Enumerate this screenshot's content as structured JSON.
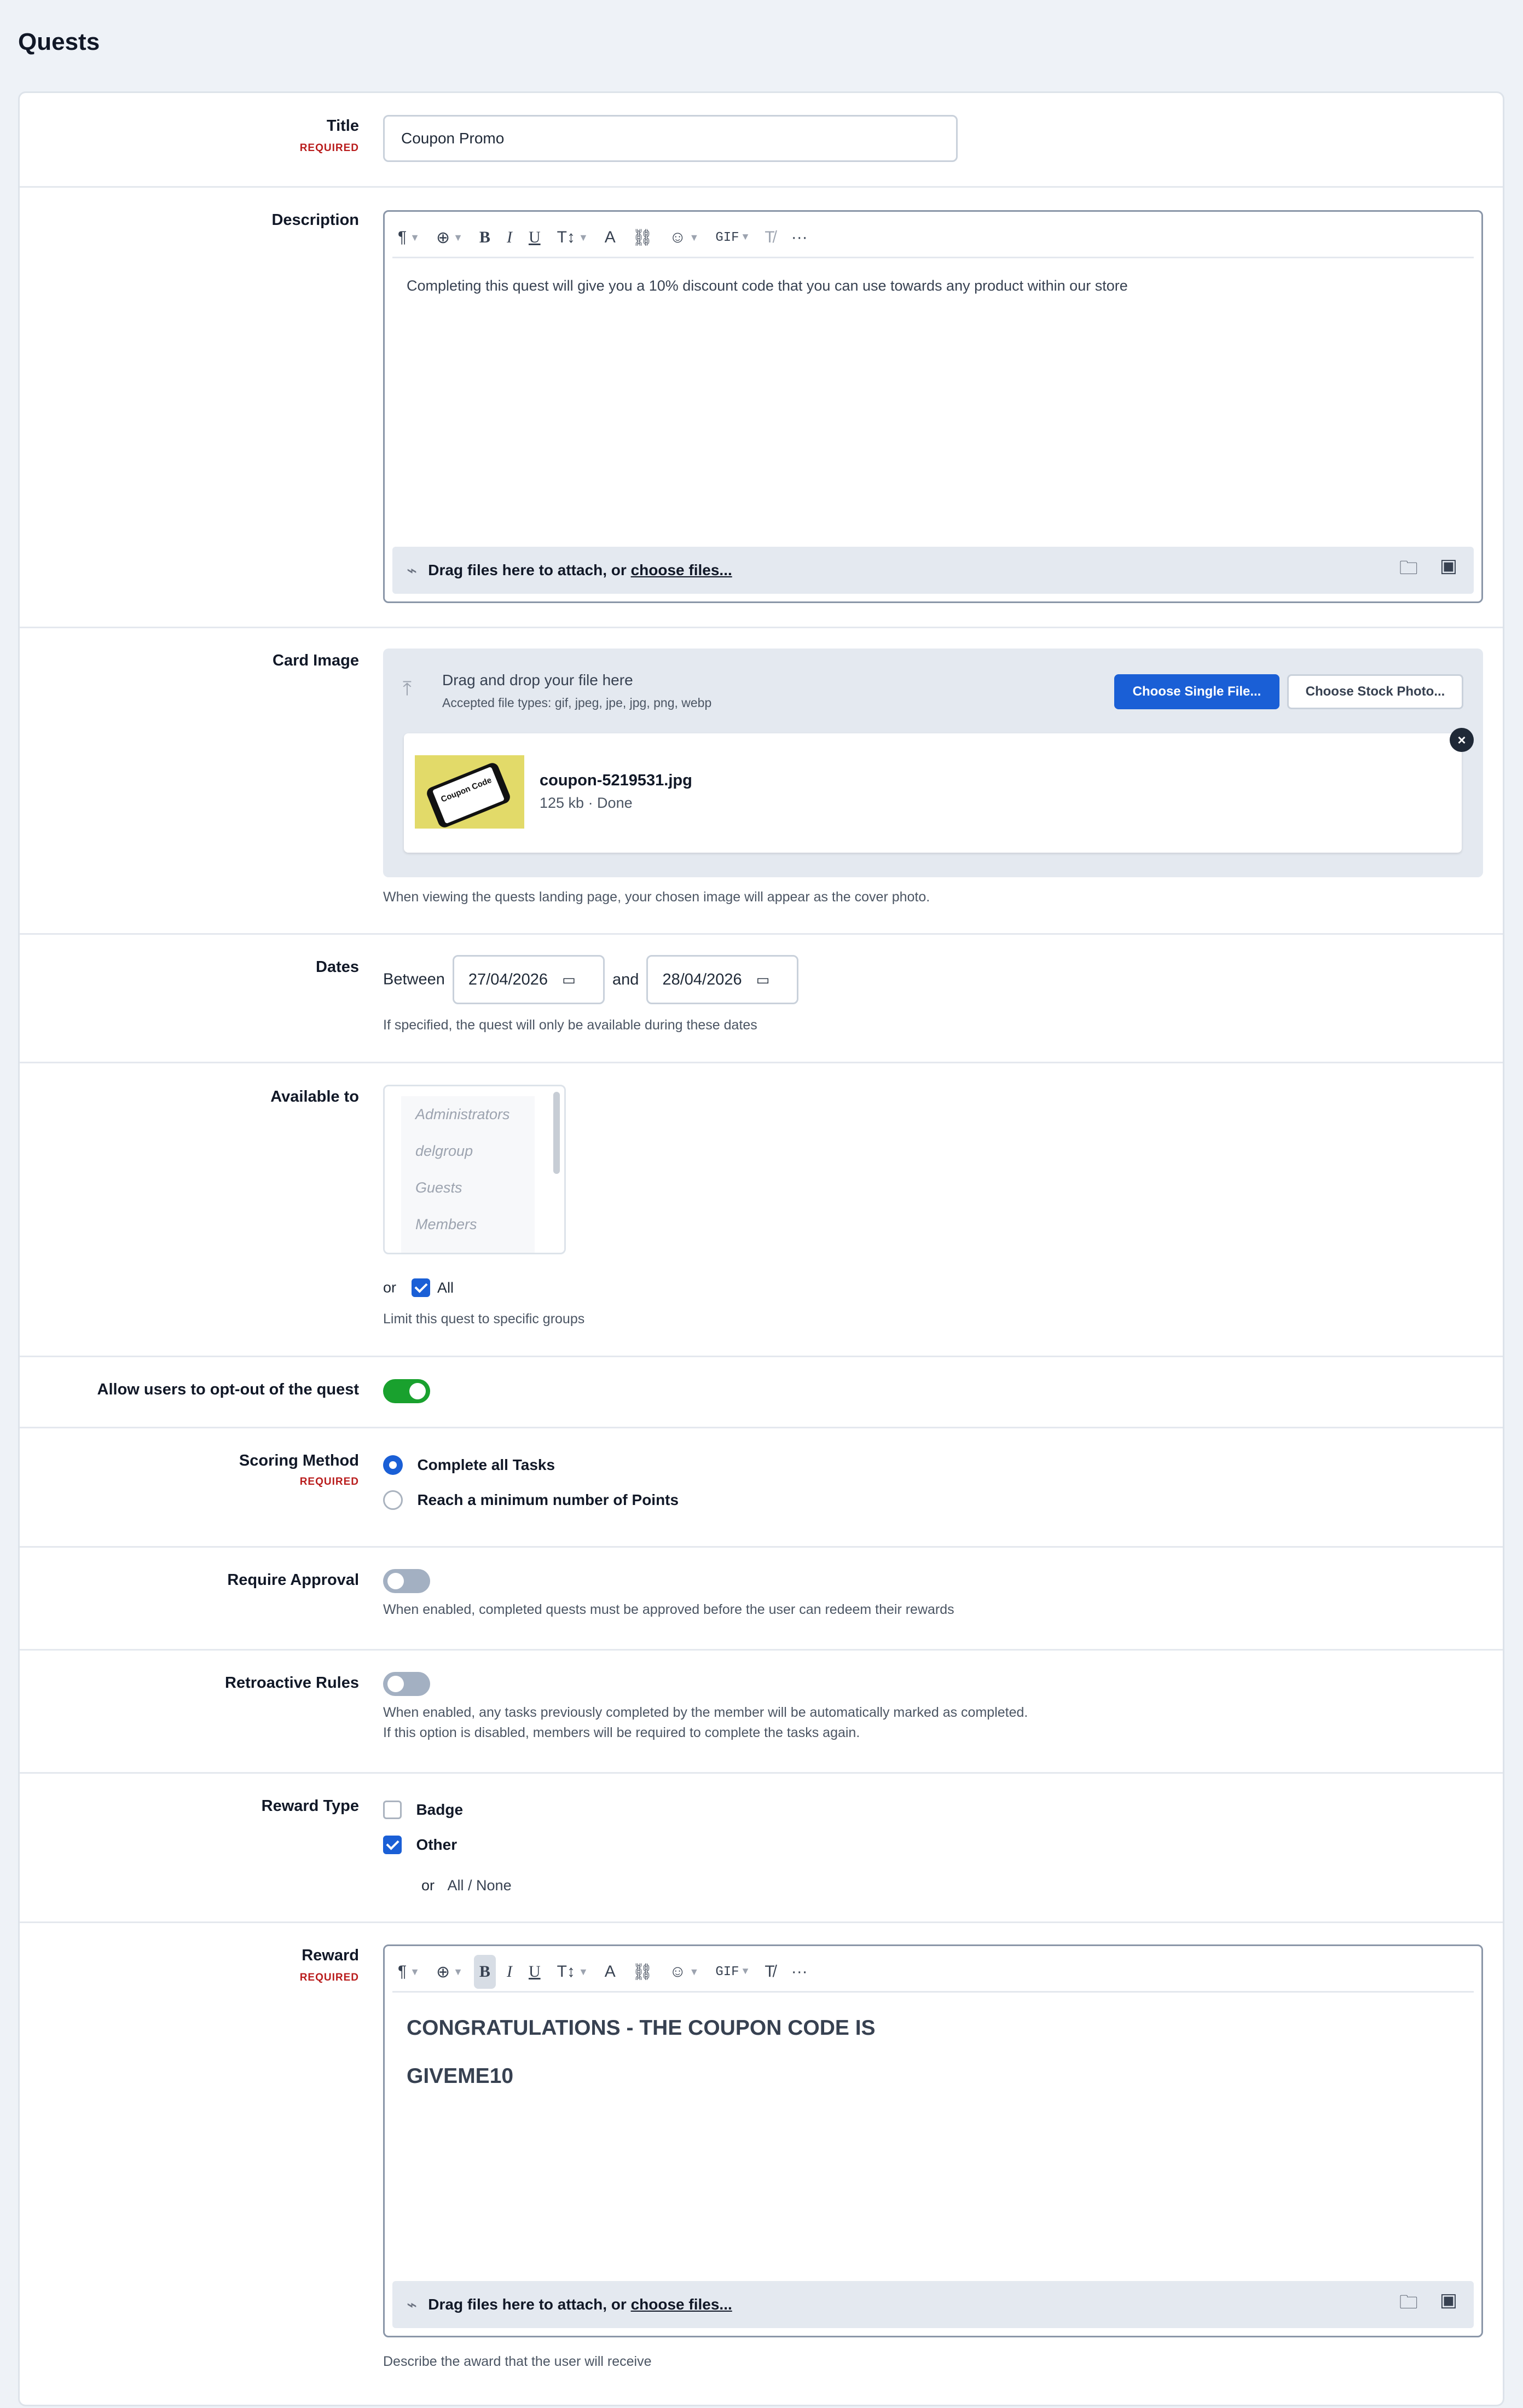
{
  "page": {
    "title": "Quests"
  },
  "title_field": {
    "label": "Title",
    "required": "REQUIRED",
    "value": "Coupon Promo"
  },
  "description": {
    "label": "Description",
    "text": "Completing this quest will give you a 10% discount code that you can use towards any product within our store",
    "attach_text": "Drag files here to attach, or ",
    "attach_link": "choose files..."
  },
  "toolbar": {
    "paragraph": "¶",
    "insert": "⊕",
    "bold": "B",
    "italic": "I",
    "underline": "U",
    "text_size": "T↕",
    "text_style": "A",
    "link": "⛓",
    "emoji": "☺",
    "gif": "GIF",
    "clear_format": "T̸",
    "more": "···"
  },
  "card_image": {
    "label": "Card Image",
    "drop_title": "Drag and drop your file here",
    "accepted": "Accepted file types: gif, jpeg, jpe, jpg, png, webp",
    "choose_single": "Choose Single File...",
    "choose_stock": "Choose Stock Photo...",
    "file_name": "coupon-5219531.jpg",
    "file_status": "125 kb · Done",
    "thumb_text": "Coupon Code",
    "hint": "When viewing the quests landing page, your chosen image will appear as the cover photo."
  },
  "dates": {
    "label": "Dates",
    "between": "Between",
    "start": "27/04/2026",
    "and": "and",
    "end": "28/04/2026",
    "hint": "If specified, the quest will only be available during these dates"
  },
  "available_to": {
    "label": "Available to",
    "groups": [
      "Administrators",
      "delgroup",
      "Guests",
      "Members"
    ],
    "or": "or",
    "all_label": "All",
    "hint": "Limit this quest to specific groups"
  },
  "opt_out": {
    "label": "Allow users to opt-out of the quest",
    "enabled": true
  },
  "scoring": {
    "label": "Scoring Method",
    "required": "REQUIRED",
    "options": [
      "Complete all Tasks",
      "Reach a minimum number of Points"
    ]
  },
  "require_approval": {
    "label": "Require Approval",
    "hint": "When enabled, completed quests must be approved before the user can redeem their rewards"
  },
  "retroactive": {
    "label": "Retroactive Rules",
    "hint1": "When enabled, any tasks previously completed by the member will be automatically marked as completed.",
    "hint2": "If this option is disabled, members will be required to complete the tasks again."
  },
  "reward_type": {
    "label": "Reward Type",
    "options": [
      "Badge",
      "Other"
    ],
    "or": "or",
    "all_none": "All / None"
  },
  "reward": {
    "label": "Reward",
    "required": "REQUIRED",
    "line1": "CONGRATULATIONS - THE COUPON CODE IS",
    "line2": "GIVEME10",
    "attach_text": "Drag files here to attach, or ",
    "attach_link": "choose files...",
    "hint": "Describe the award that the user will receive"
  },
  "colors": {
    "accent": "#1a5fd6",
    "toggle_on": "#19a12e",
    "toggle_off": "#a3b0c2",
    "required": "#b91c1c"
  }
}
